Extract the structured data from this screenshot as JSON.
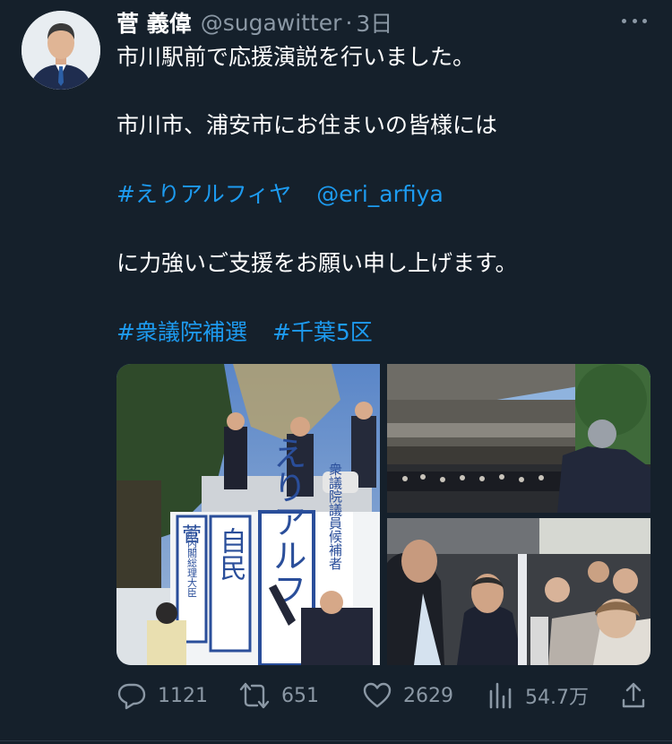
{
  "author": {
    "name": "菅 義偉",
    "handle": "@sugawitter",
    "time": "3日"
  },
  "tweet": {
    "line1": "市川駅前で応援演説を行いました。",
    "line2": "市川市、浦安市にお住まいの皆様には",
    "hashtag1": "#えりアルフィヤ",
    "mention": "@eri_arfiya",
    "line4": "に力強いご支援をお願い申し上げます。",
    "hashtag2": "#衆議院補選",
    "hashtag3": "#千葉5区"
  },
  "media": {
    "image1_sign_name": "えりアルフ",
    "image1_sign_party": "自民",
    "image1_sign_label": "衆議院議員候補者",
    "image1_sign_side": "菅",
    "image1_sign_side_sub": "前内閣総理大臣"
  },
  "stats": {
    "replies": "1121",
    "retweets": "651",
    "likes": "2629",
    "views": "54.7万"
  },
  "colors": {
    "background": "#15202b",
    "link": "#1d9bf0",
    "secondary_text": "#8b98a5"
  },
  "icons": {
    "reply": "speech-bubble",
    "retweet": "retweet-arrows",
    "like": "heart",
    "views": "bar-chart",
    "share": "upload-arrow",
    "more": "three-dots"
  }
}
